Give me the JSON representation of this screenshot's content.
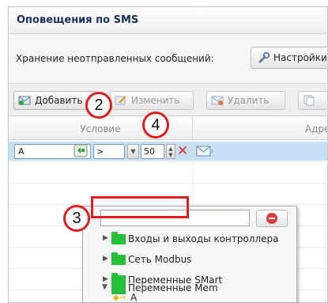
{
  "panel": {
    "title": "Оповещения по SMS"
  },
  "storage": {
    "label": "Хранение неотправленных сообщений:",
    "settings_button": "Настройки"
  },
  "toolbar": {
    "add_label": "Добавить",
    "edit_label": "Изменить",
    "delete_label": "Удалить"
  },
  "grid": {
    "columns": {
      "condition": "Условие",
      "address": "Адре"
    },
    "edit_row": {
      "variable_value": "A",
      "operator_value": ">",
      "number_value": "50"
    }
  },
  "popup": {
    "search_value": "",
    "tree": [
      {
        "label": "Входы и выходы контроллера",
        "expanded": false
      },
      {
        "label": "Сеть Modbus",
        "expanded": false
      },
      {
        "label": "Переменные SMart",
        "expanded": false
      },
      {
        "label": "Переменные Mem",
        "expanded": true
      }
    ],
    "leaf": {
      "label": "A"
    }
  },
  "callouts": {
    "c2": "2",
    "c3": "3",
    "c4": "4"
  },
  "colors": {
    "highlight_red": "#e01e1e",
    "selected_row": "#c9dff5",
    "folder_green": "#23c03a",
    "title_blue": "#1a3060"
  }
}
